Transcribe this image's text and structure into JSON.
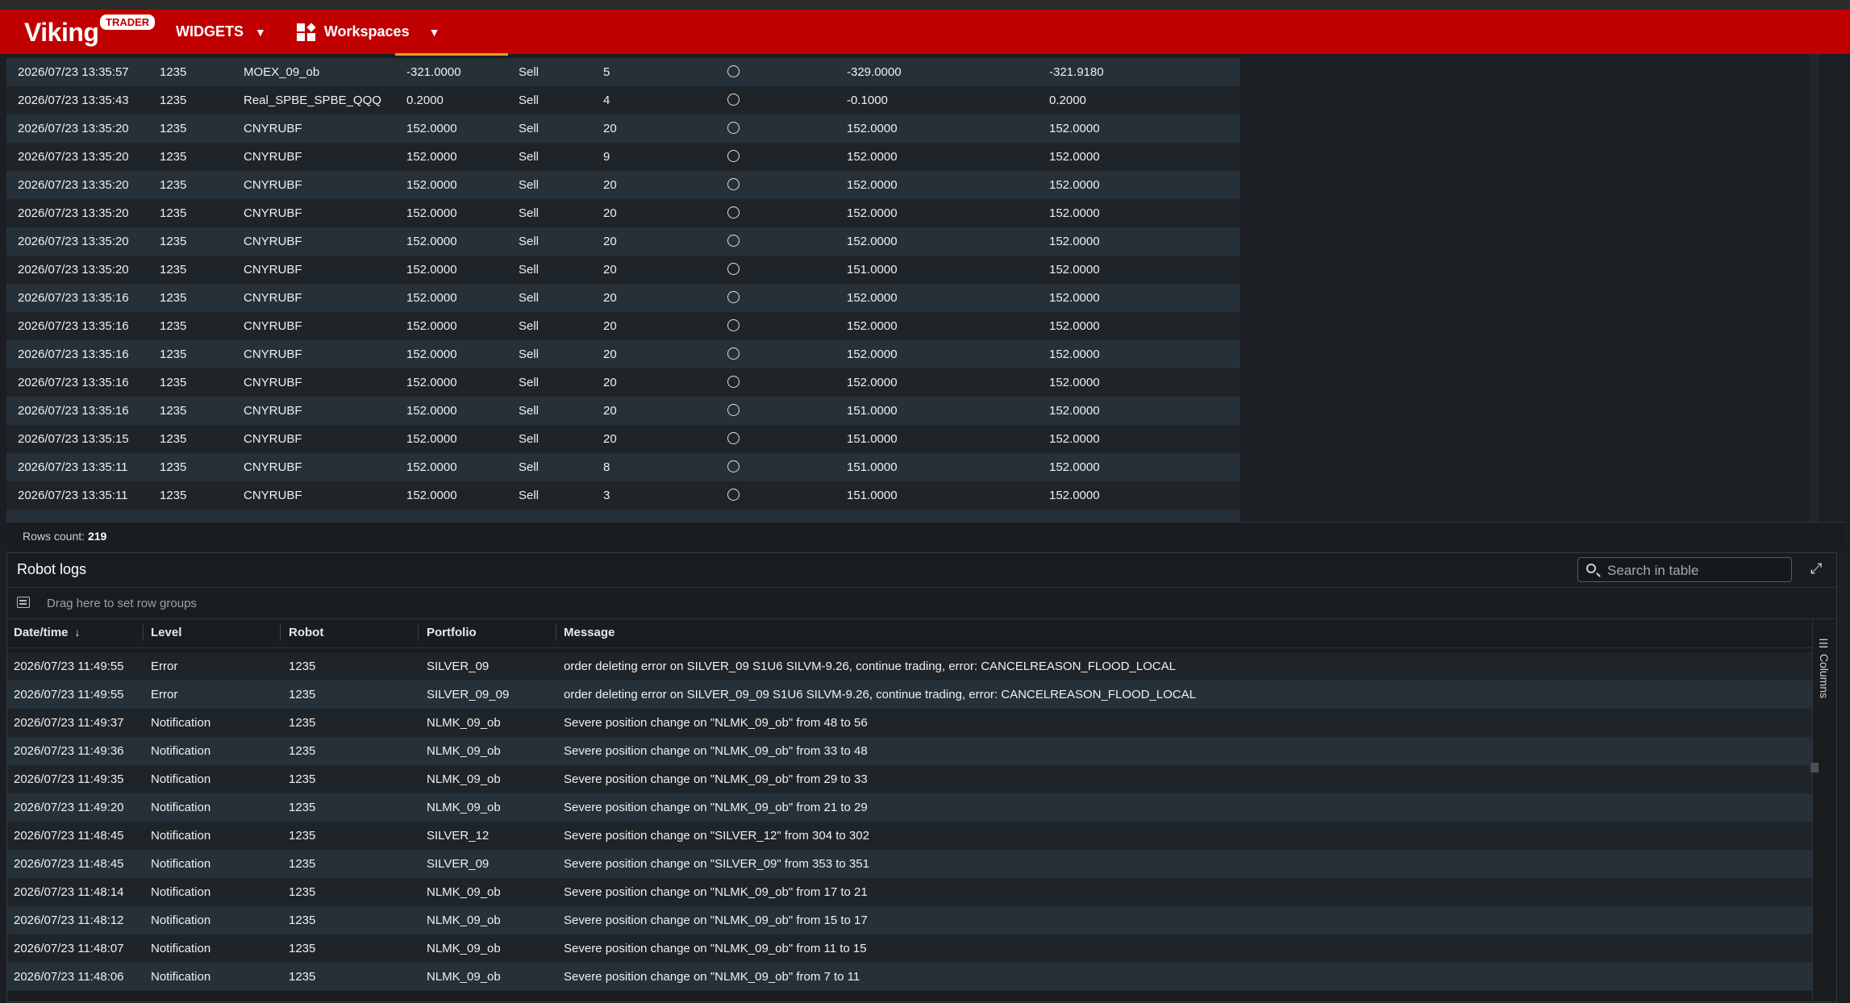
{
  "header": {
    "logo_text": "Viking",
    "logo_badge": "TRADER",
    "widgets_label": "WIDGETS",
    "workspaces_label": "Workspaces"
  },
  "orders": {
    "rows": [
      [
        "2026/07/23 13:35:57",
        "1235",
        "MOEX_09_ob",
        "-321.0000",
        "Sell",
        "5",
        "-329.0000",
        "-321.9180"
      ],
      [
        "2026/07/23 13:35:43",
        "1235",
        "Real_SPBE_SPBE_QQQ",
        "0.2000",
        "Sell",
        "4",
        "-0.1000",
        "0.2000"
      ],
      [
        "2026/07/23 13:35:20",
        "1235",
        "CNYRUBF",
        "152.0000",
        "Sell",
        "20",
        "152.0000",
        "152.0000"
      ],
      [
        "2026/07/23 13:35:20",
        "1235",
        "CNYRUBF",
        "152.0000",
        "Sell",
        "9",
        "152.0000",
        "152.0000"
      ],
      [
        "2026/07/23 13:35:20",
        "1235",
        "CNYRUBF",
        "152.0000",
        "Sell",
        "20",
        "152.0000",
        "152.0000"
      ],
      [
        "2026/07/23 13:35:20",
        "1235",
        "CNYRUBF",
        "152.0000",
        "Sell",
        "20",
        "152.0000",
        "152.0000"
      ],
      [
        "2026/07/23 13:35:20",
        "1235",
        "CNYRUBF",
        "152.0000",
        "Sell",
        "20",
        "152.0000",
        "152.0000"
      ],
      [
        "2026/07/23 13:35:20",
        "1235",
        "CNYRUBF",
        "152.0000",
        "Sell",
        "20",
        "151.0000",
        "152.0000"
      ],
      [
        "2026/07/23 13:35:16",
        "1235",
        "CNYRUBF",
        "152.0000",
        "Sell",
        "20",
        "152.0000",
        "152.0000"
      ],
      [
        "2026/07/23 13:35:16",
        "1235",
        "CNYRUBF",
        "152.0000",
        "Sell",
        "20",
        "152.0000",
        "152.0000"
      ],
      [
        "2026/07/23 13:35:16",
        "1235",
        "CNYRUBF",
        "152.0000",
        "Sell",
        "20",
        "152.0000",
        "152.0000"
      ],
      [
        "2026/07/23 13:35:16",
        "1235",
        "CNYRUBF",
        "152.0000",
        "Sell",
        "20",
        "152.0000",
        "152.0000"
      ],
      [
        "2026/07/23 13:35:16",
        "1235",
        "CNYRUBF",
        "152.0000",
        "Sell",
        "20",
        "151.0000",
        "152.0000"
      ],
      [
        "2026/07/23 13:35:15",
        "1235",
        "CNYRUBF",
        "152.0000",
        "Sell",
        "20",
        "151.0000",
        "152.0000"
      ],
      [
        "2026/07/23 13:35:11",
        "1235",
        "CNYRUBF",
        "152.0000",
        "Sell",
        "8",
        "151.0000",
        "152.0000"
      ],
      [
        "2026/07/23 13:35:11",
        "1235",
        "CNYRUBF",
        "152.0000",
        "Sell",
        "3",
        "151.0000",
        "152.0000"
      ]
    ],
    "rows_count_label": "Rows count:",
    "rows_count": "219"
  },
  "logs": {
    "title": "Robot logs",
    "search_placeholder": "Search in table",
    "group_hint": "Drag here to set row groups",
    "columns_label": "Columns",
    "headers": [
      "Date/time",
      "Level",
      "Robot",
      "Portfolio",
      "Message"
    ],
    "rows": [
      [
        "2026/07/23 11:49:55",
        "Error",
        "1235",
        "SILVER_09",
        "order deleting error on SILVER_09 S1U6 SILVM-9.26, continue trading, error: CANCELREASON_FLOOD_LOCAL"
      ],
      [
        "2026/07/23 11:49:55",
        "Error",
        "1235",
        "SILVER_09_09",
        "order deleting error on SILVER_09_09 S1U6 SILVM-9.26, continue trading, error: CANCELREASON_FLOOD_LOCAL"
      ],
      [
        "2026/07/23 11:49:37",
        "Notification",
        "1235",
        "NLMK_09_ob",
        "Severe position change on \"NLMK_09_ob\" from 48 to 56"
      ],
      [
        "2026/07/23 11:49:36",
        "Notification",
        "1235",
        "NLMK_09_ob",
        "Severe position change on \"NLMK_09_ob\" from 33 to 48"
      ],
      [
        "2026/07/23 11:49:35",
        "Notification",
        "1235",
        "NLMK_09_ob",
        "Severe position change on \"NLMK_09_ob\" from 29 to 33"
      ],
      [
        "2026/07/23 11:49:20",
        "Notification",
        "1235",
        "NLMK_09_ob",
        "Severe position change on \"NLMK_09_ob\" from 21 to 29"
      ],
      [
        "2026/07/23 11:48:45",
        "Notification",
        "1235",
        "SILVER_12",
        "Severe position change on \"SILVER_12\" from 304 to 302"
      ],
      [
        "2026/07/23 11:48:45",
        "Notification",
        "1235",
        "SILVER_09",
        "Severe position change on \"SILVER_09\" from 353 to 351"
      ],
      [
        "2026/07/23 11:48:14",
        "Notification",
        "1235",
        "NLMK_09_ob",
        "Severe position change on \"NLMK_09_ob\" from 17 to 21"
      ],
      [
        "2026/07/23 11:48:12",
        "Notification",
        "1235",
        "NLMK_09_ob",
        "Severe position change on \"NLMK_09_ob\" from 15 to 17"
      ],
      [
        "2026/07/23 11:48:07",
        "Notification",
        "1235",
        "NLMK_09_ob",
        "Severe position change on \"NLMK_09_ob\" from 11 to 15"
      ],
      [
        "2026/07/23 11:48:06",
        "Notification",
        "1235",
        "NLMK_09_ob",
        "Severe position change on \"NLMK_09_ob\" from 7 to 11"
      ]
    ]
  },
  "colors": {
    "header_red": "#c00000",
    "row_even": "#263038",
    "row_odd": "#1f2428",
    "background": "#1b1e22"
  }
}
